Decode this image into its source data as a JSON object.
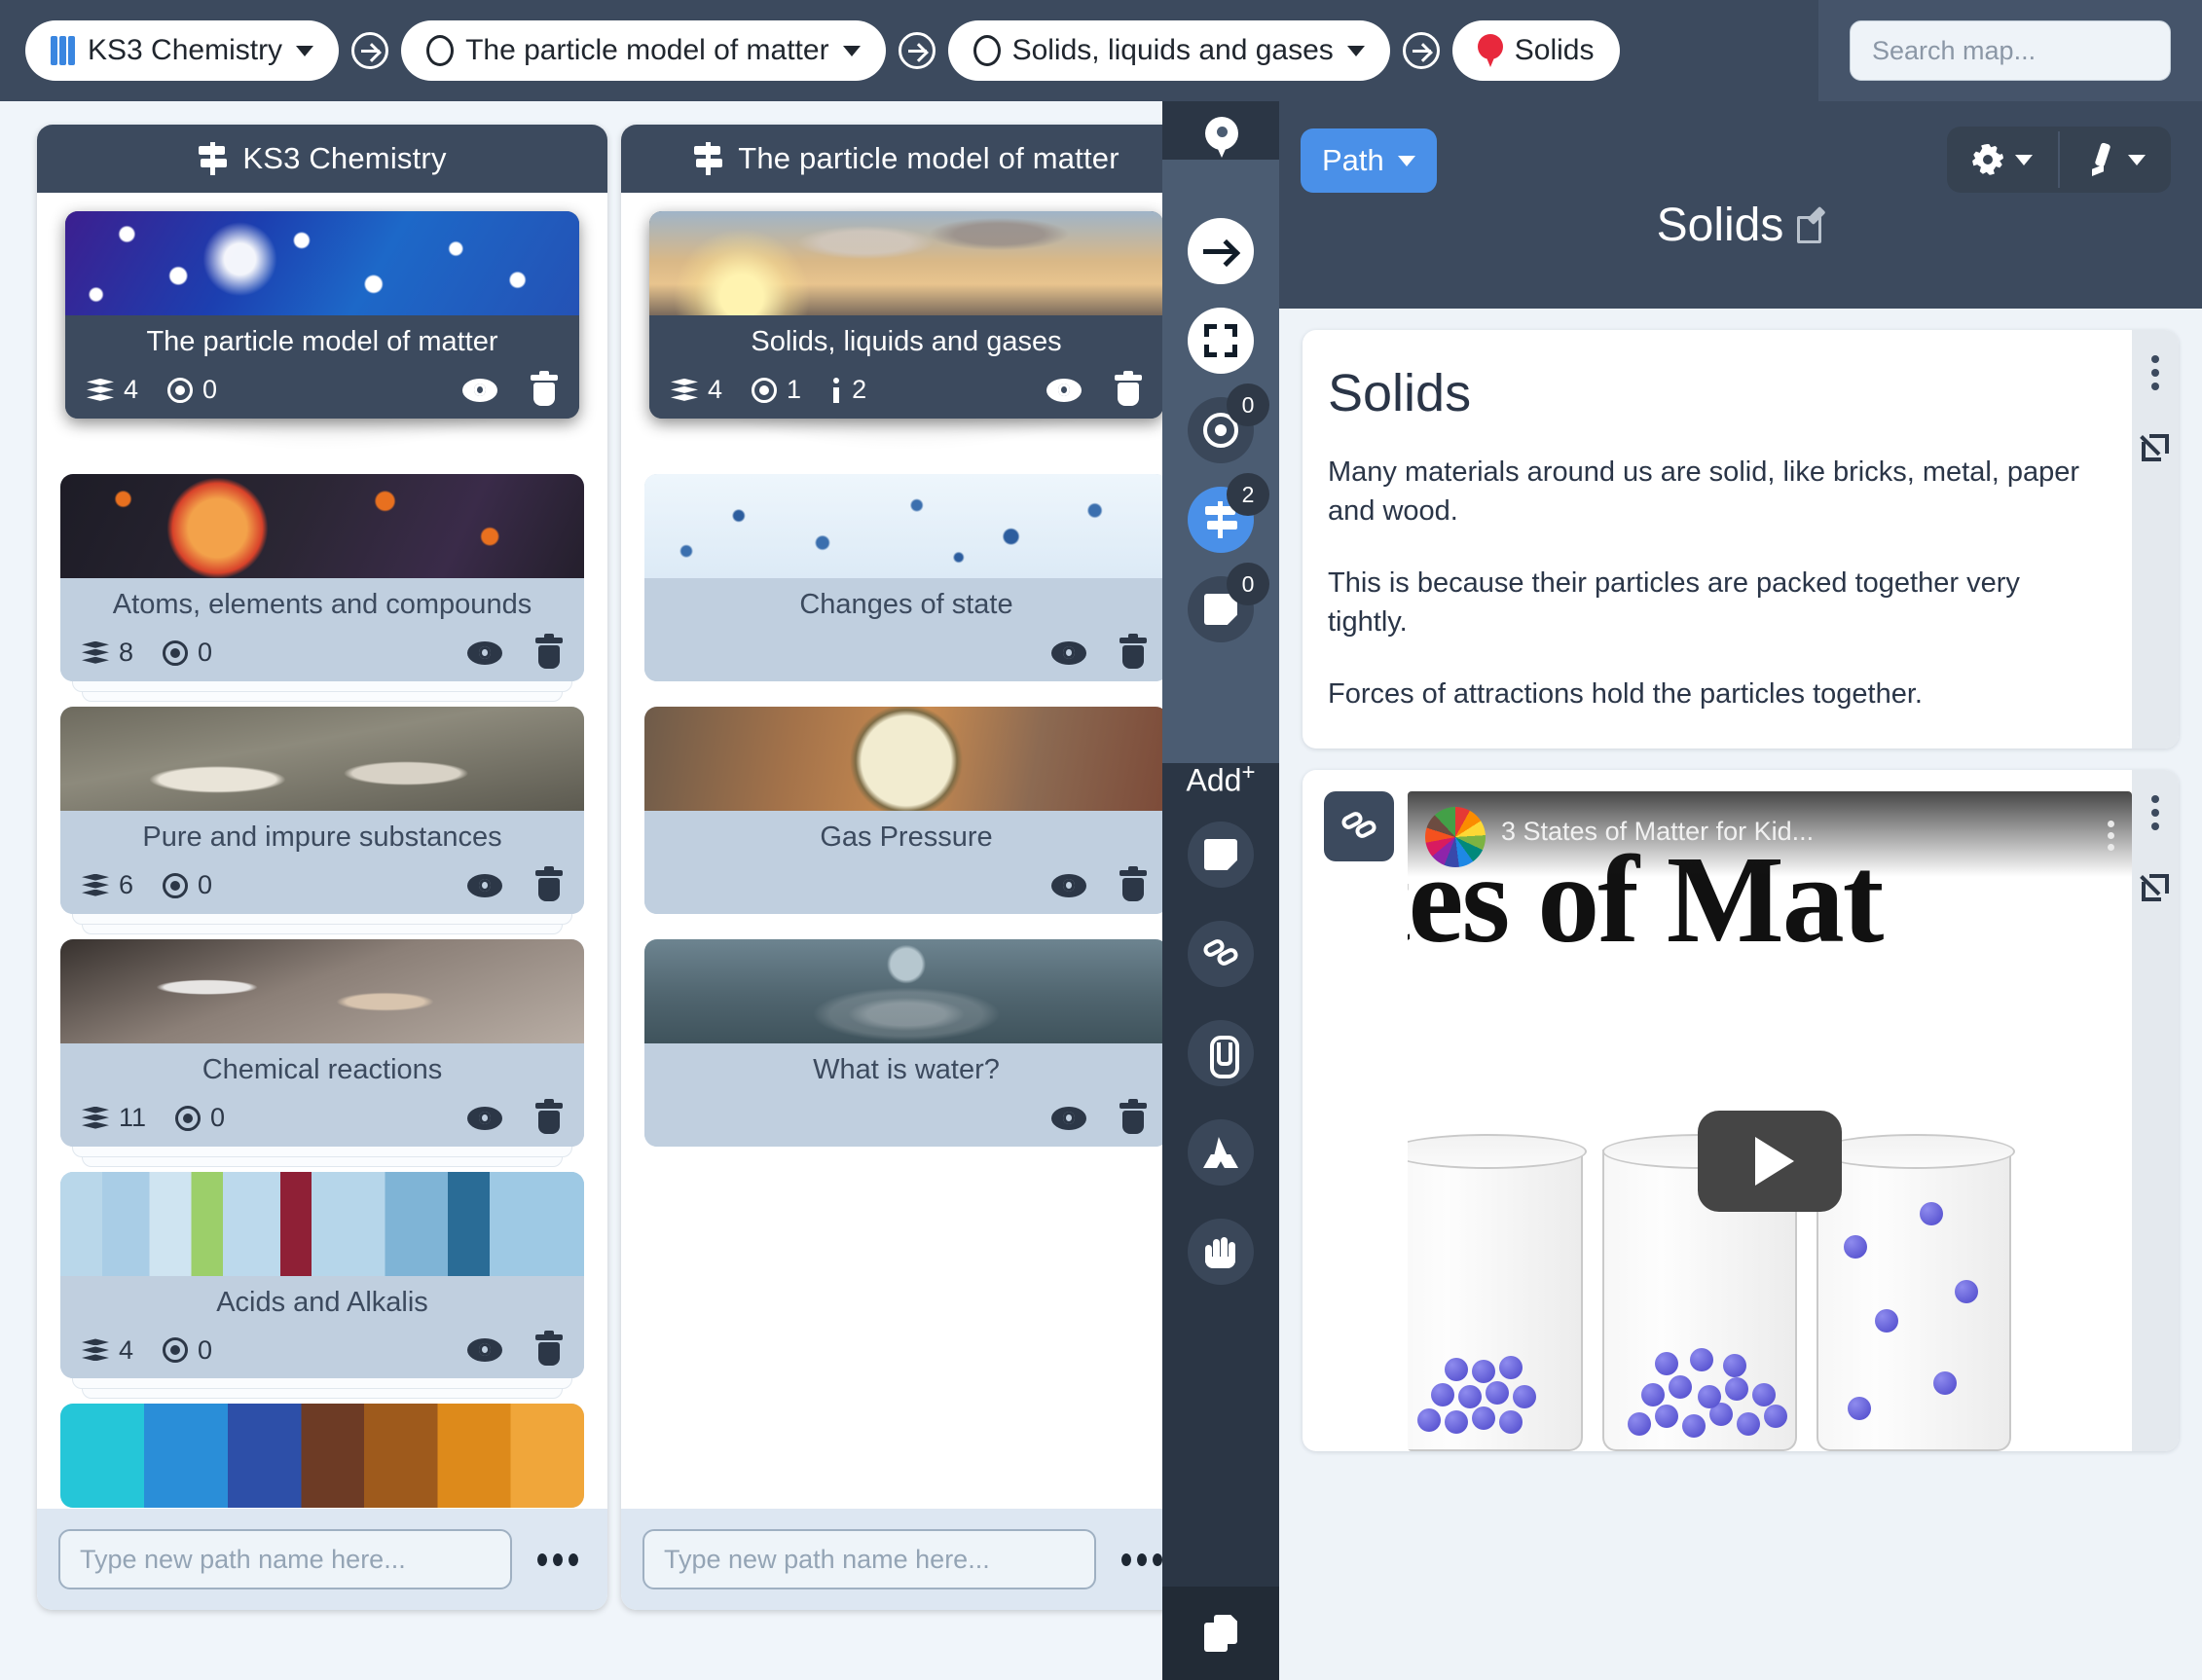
{
  "topbar": {
    "breadcrumb": [
      {
        "label": "KS3 Chemistry",
        "icon": "book-icon",
        "has_caret": true
      },
      {
        "label": "The particle model of matter",
        "icon": "ring-icon",
        "has_caret": true
      },
      {
        "label": "Solids, liquids and gases",
        "icon": "ring-icon",
        "has_caret": true
      },
      {
        "label": "Solids",
        "icon": "map-pin-icon",
        "has_caret": false
      }
    ],
    "search": {
      "placeholder": "Search map...",
      "value": ""
    }
  },
  "columns": [
    {
      "title": "KS3 Chemistry",
      "footer_input_placeholder": "Type new path name here...",
      "cards": [
        {
          "title": "The particle model of matter",
          "layers": "4",
          "targets": "0",
          "info": null,
          "selected": true,
          "thumb": "t-atom"
        },
        {
          "title": "Atoms, elements and compounds",
          "layers": "8",
          "targets": "0",
          "info": null,
          "selected": false,
          "thumb": "t-atoms2"
        },
        {
          "title": "Pure and impure substances",
          "layers": "6",
          "targets": "0",
          "info": null,
          "selected": false,
          "thumb": "t-lab"
        },
        {
          "title": "Chemical reactions",
          "layers": "11",
          "targets": "0",
          "info": null,
          "selected": false,
          "thumb": "t-chem"
        },
        {
          "title": "Acids and Alkalis",
          "layers": "4",
          "targets": "0",
          "info": null,
          "selected": false,
          "thumb": "t-acids"
        },
        {
          "title": "",
          "layers": null,
          "targets": null,
          "info": null,
          "selected": false,
          "thumb": "t-periodic"
        }
      ]
    },
    {
      "title": "The particle model of matter",
      "footer_input_placeholder": "Type new path name here...",
      "cards": [
        {
          "title": "Solids, liquids and gases",
          "layers": "4",
          "targets": "1",
          "info": "2",
          "selected": true,
          "thumb": "t-power"
        },
        {
          "title": "Changes of state",
          "layers": null,
          "targets": null,
          "info": null,
          "selected": false,
          "thumb": "t-bubbles"
        },
        {
          "title": "Gas Pressure",
          "layers": null,
          "targets": null,
          "info": null,
          "selected": false,
          "thumb": "t-gauge"
        },
        {
          "title": "What is water?",
          "layers": null,
          "targets": null,
          "info": null,
          "selected": false,
          "thumb": "t-water"
        }
      ]
    }
  ],
  "rail": {
    "tools": [
      {
        "name": "arrow-right-icon",
        "style": "white",
        "count": null
      },
      {
        "name": "expand-frame-icon",
        "style": "white",
        "count": null
      },
      {
        "name": "target-icon",
        "style": "dark",
        "count": "0"
      },
      {
        "name": "signpost-icon",
        "style": "blue",
        "count": "2"
      },
      {
        "name": "note-icon",
        "style": "dark",
        "count": "0"
      }
    ],
    "add_label": "Add",
    "add_superscript": "+",
    "add_tools": [
      {
        "name": "note-icon"
      },
      {
        "name": "link-icon"
      },
      {
        "name": "paperclip-icon"
      },
      {
        "name": "google-drive-icon"
      },
      {
        "name": "hand-icon"
      }
    ],
    "bottom_tool": {
      "name": "copy-icon"
    }
  },
  "right_panel": {
    "path_button": "Path",
    "page_title": "Solids",
    "note_card": {
      "heading": "Solids",
      "paragraphs": [
        "Many materials around us are solid, like bricks, metal, paper and wood.",
        "This is because their particles are packed together very tightly.",
        "Forces of attractions hold the particles together."
      ]
    },
    "video_card": {
      "video_title": "3 States of Matter for Kid...",
      "overlay_text": "tes of Mat"
    }
  },
  "colors": {
    "accent_blue": "#4a90e8",
    "dark_slate": "#3c4a5e",
    "card_blue": "#c0cfdf",
    "pin_red": "#e8283c",
    "page_bg": "#eef3f8"
  }
}
